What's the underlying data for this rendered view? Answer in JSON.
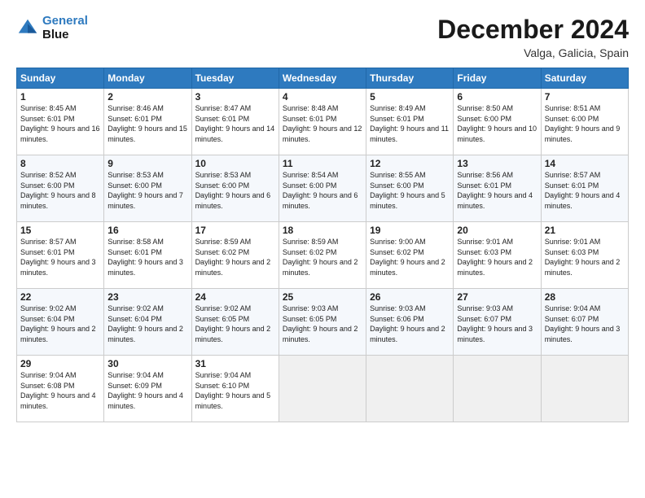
{
  "logo": {
    "line1": "General",
    "line2": "Blue"
  },
  "title": "December 2024",
  "location": "Valga, Galicia, Spain",
  "days_of_week": [
    "Sunday",
    "Monday",
    "Tuesday",
    "Wednesday",
    "Thursday",
    "Friday",
    "Saturday"
  ],
  "weeks": [
    [
      {
        "day": "1",
        "sunrise": "8:45 AM",
        "sunset": "6:01 PM",
        "daylight": "9 hours and 16 minutes."
      },
      {
        "day": "2",
        "sunrise": "8:46 AM",
        "sunset": "6:01 PM",
        "daylight": "9 hours and 15 minutes."
      },
      {
        "day": "3",
        "sunrise": "8:47 AM",
        "sunset": "6:01 PM",
        "daylight": "9 hours and 14 minutes."
      },
      {
        "day": "4",
        "sunrise": "8:48 AM",
        "sunset": "6:01 PM",
        "daylight": "9 hours and 12 minutes."
      },
      {
        "day": "5",
        "sunrise": "8:49 AM",
        "sunset": "6:01 PM",
        "daylight": "9 hours and 11 minutes."
      },
      {
        "day": "6",
        "sunrise": "8:50 AM",
        "sunset": "6:00 PM",
        "daylight": "9 hours and 10 minutes."
      },
      {
        "day": "7",
        "sunrise": "8:51 AM",
        "sunset": "6:00 PM",
        "daylight": "9 hours and 9 minutes."
      }
    ],
    [
      {
        "day": "8",
        "sunrise": "8:52 AM",
        "sunset": "6:00 PM",
        "daylight": "9 hours and 8 minutes."
      },
      {
        "day": "9",
        "sunrise": "8:53 AM",
        "sunset": "6:00 PM",
        "daylight": "9 hours and 7 minutes."
      },
      {
        "day": "10",
        "sunrise": "8:53 AM",
        "sunset": "6:00 PM",
        "daylight": "9 hours and 6 minutes."
      },
      {
        "day": "11",
        "sunrise": "8:54 AM",
        "sunset": "6:00 PM",
        "daylight": "9 hours and 6 minutes."
      },
      {
        "day": "12",
        "sunrise": "8:55 AM",
        "sunset": "6:00 PM",
        "daylight": "9 hours and 5 minutes."
      },
      {
        "day": "13",
        "sunrise": "8:56 AM",
        "sunset": "6:01 PM",
        "daylight": "9 hours and 4 minutes."
      },
      {
        "day": "14",
        "sunrise": "8:57 AM",
        "sunset": "6:01 PM",
        "daylight": "9 hours and 4 minutes."
      }
    ],
    [
      {
        "day": "15",
        "sunrise": "8:57 AM",
        "sunset": "6:01 PM",
        "daylight": "9 hours and 3 minutes."
      },
      {
        "day": "16",
        "sunrise": "8:58 AM",
        "sunset": "6:01 PM",
        "daylight": "9 hours and 3 minutes."
      },
      {
        "day": "17",
        "sunrise": "8:59 AM",
        "sunset": "6:02 PM",
        "daylight": "9 hours and 2 minutes."
      },
      {
        "day": "18",
        "sunrise": "8:59 AM",
        "sunset": "6:02 PM",
        "daylight": "9 hours and 2 minutes."
      },
      {
        "day": "19",
        "sunrise": "9:00 AM",
        "sunset": "6:02 PM",
        "daylight": "9 hours and 2 minutes."
      },
      {
        "day": "20",
        "sunrise": "9:01 AM",
        "sunset": "6:03 PM",
        "daylight": "9 hours and 2 minutes."
      },
      {
        "day": "21",
        "sunrise": "9:01 AM",
        "sunset": "6:03 PM",
        "daylight": "9 hours and 2 minutes."
      }
    ],
    [
      {
        "day": "22",
        "sunrise": "9:02 AM",
        "sunset": "6:04 PM",
        "daylight": "9 hours and 2 minutes."
      },
      {
        "day": "23",
        "sunrise": "9:02 AM",
        "sunset": "6:04 PM",
        "daylight": "9 hours and 2 minutes."
      },
      {
        "day": "24",
        "sunrise": "9:02 AM",
        "sunset": "6:05 PM",
        "daylight": "9 hours and 2 minutes."
      },
      {
        "day": "25",
        "sunrise": "9:03 AM",
        "sunset": "6:05 PM",
        "daylight": "9 hours and 2 minutes."
      },
      {
        "day": "26",
        "sunrise": "9:03 AM",
        "sunset": "6:06 PM",
        "daylight": "9 hours and 2 minutes."
      },
      {
        "day": "27",
        "sunrise": "9:03 AM",
        "sunset": "6:07 PM",
        "daylight": "9 hours and 3 minutes."
      },
      {
        "day": "28",
        "sunrise": "9:04 AM",
        "sunset": "6:07 PM",
        "daylight": "9 hours and 3 minutes."
      }
    ],
    [
      {
        "day": "29",
        "sunrise": "9:04 AM",
        "sunset": "6:08 PM",
        "daylight": "9 hours and 4 minutes."
      },
      {
        "day": "30",
        "sunrise": "9:04 AM",
        "sunset": "6:09 PM",
        "daylight": "9 hours and 4 minutes."
      },
      {
        "day": "31",
        "sunrise": "9:04 AM",
        "sunset": "6:10 PM",
        "daylight": "9 hours and 5 minutes."
      },
      null,
      null,
      null,
      null
    ]
  ]
}
